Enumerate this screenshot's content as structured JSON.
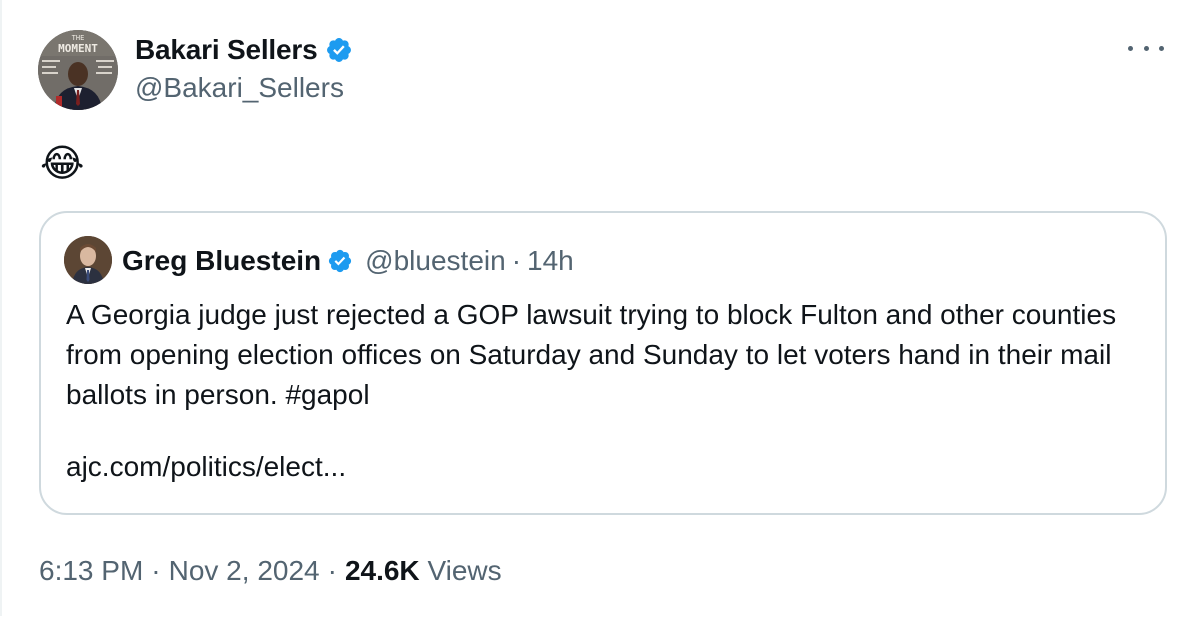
{
  "tweet": {
    "author": {
      "name": "Bakari Sellers",
      "handle": "@Bakari_Sellers",
      "verified": true,
      "avatar_icon": "book-cover-avatar",
      "avatar_text": "THE MOMENT"
    },
    "text": "😂",
    "more_icon": "more-horizontal-icon",
    "quoted": {
      "author": {
        "name": "Greg Bluestein",
        "handle": "@bluestein",
        "time": "14h",
        "verified": true,
        "avatar_icon": "person-avatar"
      },
      "text": "A Georgia judge just rejected a GOP lawsuit trying to block Fulton and other counties from opening election offices on Saturday and Sunday to let voters hand in their mail ballots in person. #gapol",
      "link": "ajc.com/politics/elect..."
    },
    "meta": {
      "time": "6:13 PM",
      "date": "Nov 2, 2024",
      "views_count": "24.6K",
      "views_label": "Views"
    }
  },
  "colors": {
    "text_primary": "#0f1419",
    "text_secondary": "#536471",
    "verified_blue": "#1d9bf0",
    "border": "#cfd9de"
  }
}
